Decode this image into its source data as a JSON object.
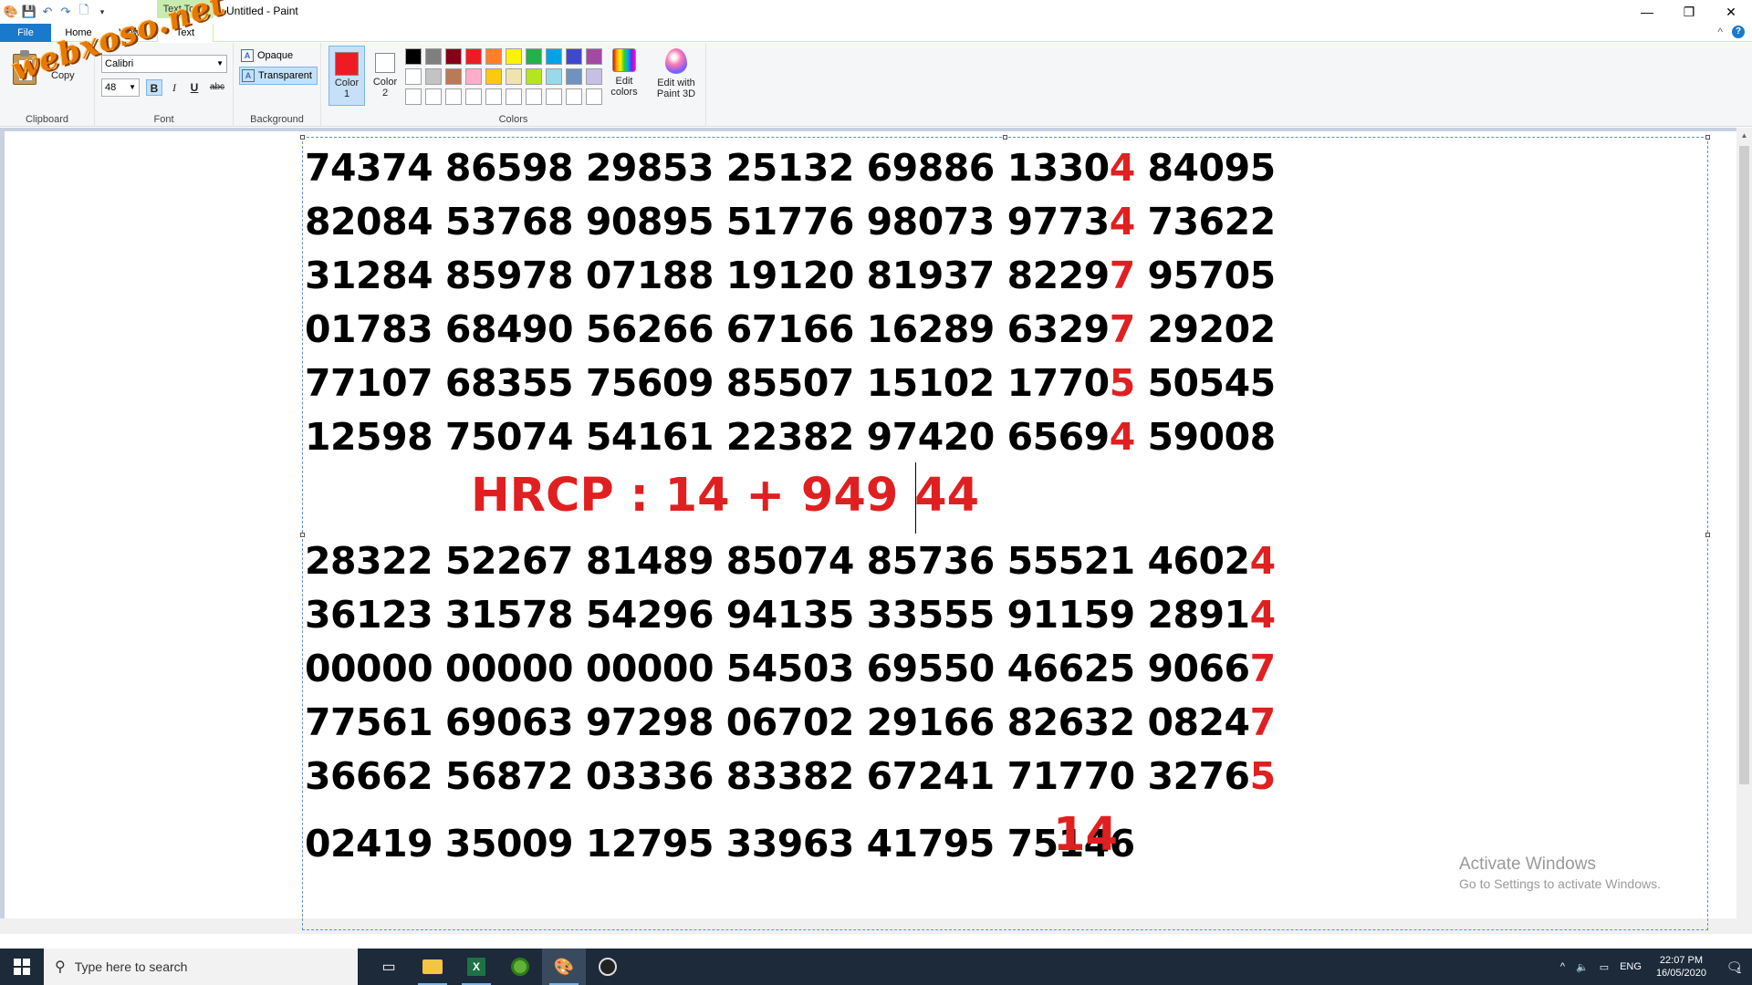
{
  "window": {
    "title": "Untitled - Paint",
    "context_tab": "Text Tools",
    "minimize": "—",
    "maximize": "❐",
    "close": "✕"
  },
  "tabs": [
    "File",
    "Home",
    "View",
    "Text"
  ],
  "watermark": "webxoso.net",
  "ribbon": {
    "clipboard": {
      "copy_label": "Copy",
      "group_label": "Clipboard"
    },
    "font": {
      "family": "Calibri",
      "size": "48",
      "bold_label": "B",
      "italic_label": "I",
      "underline_label": "U",
      "strike_label": "abc",
      "group_label": "Font"
    },
    "background": {
      "opaque_label": "Opaque",
      "transparent_label": "Transparent",
      "group_label": "Background"
    },
    "colors": {
      "color1_label": "Color",
      "color1_num": "1",
      "color2_label": "Color",
      "color2_num": "2",
      "color1": "#ed1c24",
      "color2": "#ffffff",
      "edit_colors_label": "Edit colors",
      "group_label": "Colors",
      "palette": [
        "#000000",
        "#7f7f7f",
        "#880015",
        "#ed1c24",
        "#ff7f27",
        "#fff200",
        "#22b14c",
        "#00a2e8",
        "#3f48cc",
        "#a349a4",
        "#ffffff",
        "#c3c3c3",
        "#b97a57",
        "#ffaec9",
        "#ffc90e",
        "#efe4b0",
        "#b5e61d",
        "#99d9ea",
        "#7092be",
        "#c8bfe7",
        "#ffffff",
        "#ffffff",
        "#ffffff",
        "#ffffff",
        "#ffffff",
        "#ffffff",
        "#ffffff",
        "#ffffff",
        "#ffffff",
        "#ffffff"
      ]
    },
    "paint3d_label": "Edit with Paint 3D"
  },
  "canvas": {
    "rows_top": [
      {
        "main": "74374 86598 29853 25132 69886 1330",
        "red": "4",
        "tail": " 84095"
      },
      {
        "main": "82084 53768 90895 51776 98073 9773",
        "red": "4",
        "tail": " 73622"
      },
      {
        "main": "31284 85978 07188 19120 81937 8229",
        "red": "7",
        "tail": " 95705"
      },
      {
        "main": "01783 68490 56266 67166 16289 6329",
        "red": "7",
        "tail": " 29202"
      },
      {
        "main": "77107 68355 75609 85507 15102 1770",
        "red": "5",
        "tail": " 50545"
      },
      {
        "main": "12598 75074 54161 22382 97420 6569",
        "red": "4",
        "tail": " 59008"
      }
    ],
    "hrcp": "HRCP : 14 + 949 44",
    "rows_bottom": [
      {
        "main": "28322 52267 81489 85074 85736 55521 4602",
        "red": "4"
      },
      {
        "main": "36123 31578 54296 94135 33555 91159 2891",
        "red": "4"
      },
      {
        "main": "00000 00000 00000 54503 69550 46625 9066",
        "red": "7"
      },
      {
        "main": "77561 69063 97298 06702 29166 82632 0824",
        "red": "7"
      },
      {
        "main": "36662 56872 03336 83382 67241 71770 3276",
        "red": "5"
      }
    ],
    "last_row": "02419 35009 12795 33963 41795 75146",
    "last_red": "14"
  },
  "activation": {
    "title": "Activate Windows",
    "subtitle": "Go to Settings to activate Windows."
  },
  "taskbar": {
    "search_placeholder": "Type here to search",
    "language": "ENG",
    "time": "22:07 PM",
    "date": "16/05/2020",
    "notification_count": "1"
  }
}
